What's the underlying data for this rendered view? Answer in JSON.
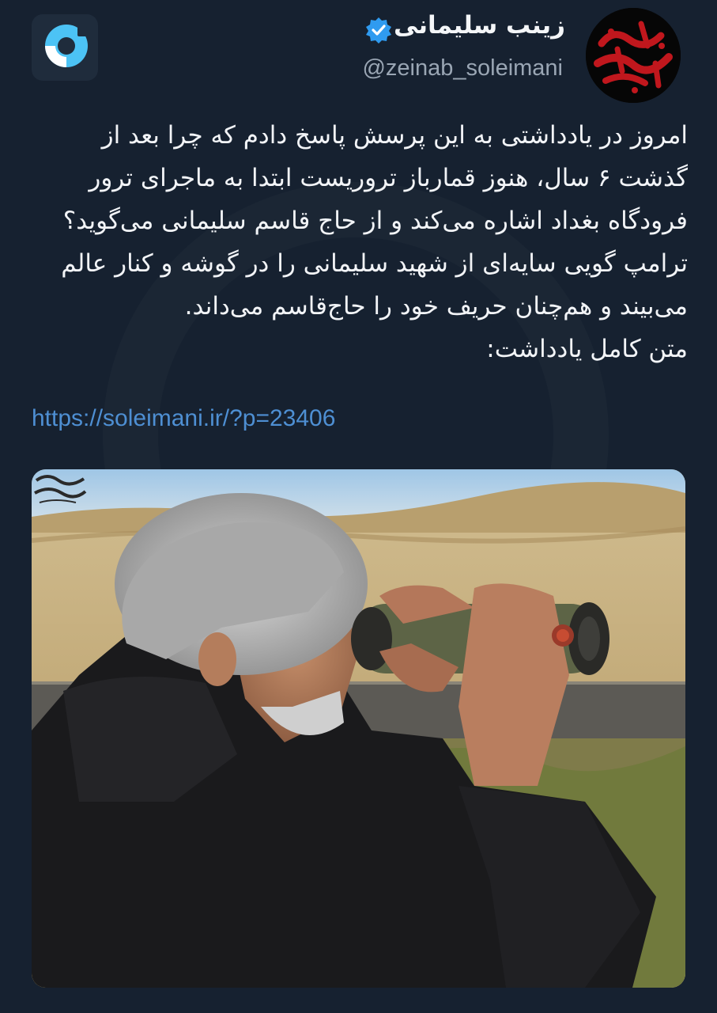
{
  "tweet": {
    "display_name": "زینب سلیمانی",
    "handle": "@zeinab_soleimani",
    "verified": true,
    "paragraphs": [
      "امروز در یادداشتی به این پرسش پاسخ دادم که چرا بعد از گذشت ۶ سال، هنوز قمارباز تروریست ابتدا به ماجرای ترور فرودگاه بغداد اشاره می‌کند و از حاج قاسم سلیمانی می‌گوید؟",
      "ترامپ گویی سایه‌ای از شهید سلیمانی را در گوشه و کنار عالم می‌بیند و هم‌چنان حریف خود را حاج‌قاسم می‌داند.",
      "متن کامل یادداشت:"
    ],
    "link": "https://soleimani.ir/?p=23406"
  },
  "icons": {
    "app": "app-logo-icon",
    "verified": "verified-badge-icon",
    "avatar": "calligraphy-avatar"
  },
  "colors": {
    "background": "#162130",
    "link": "#4e8fd3",
    "verified": "#2f9bf0",
    "handle": "#9aa6b4"
  }
}
